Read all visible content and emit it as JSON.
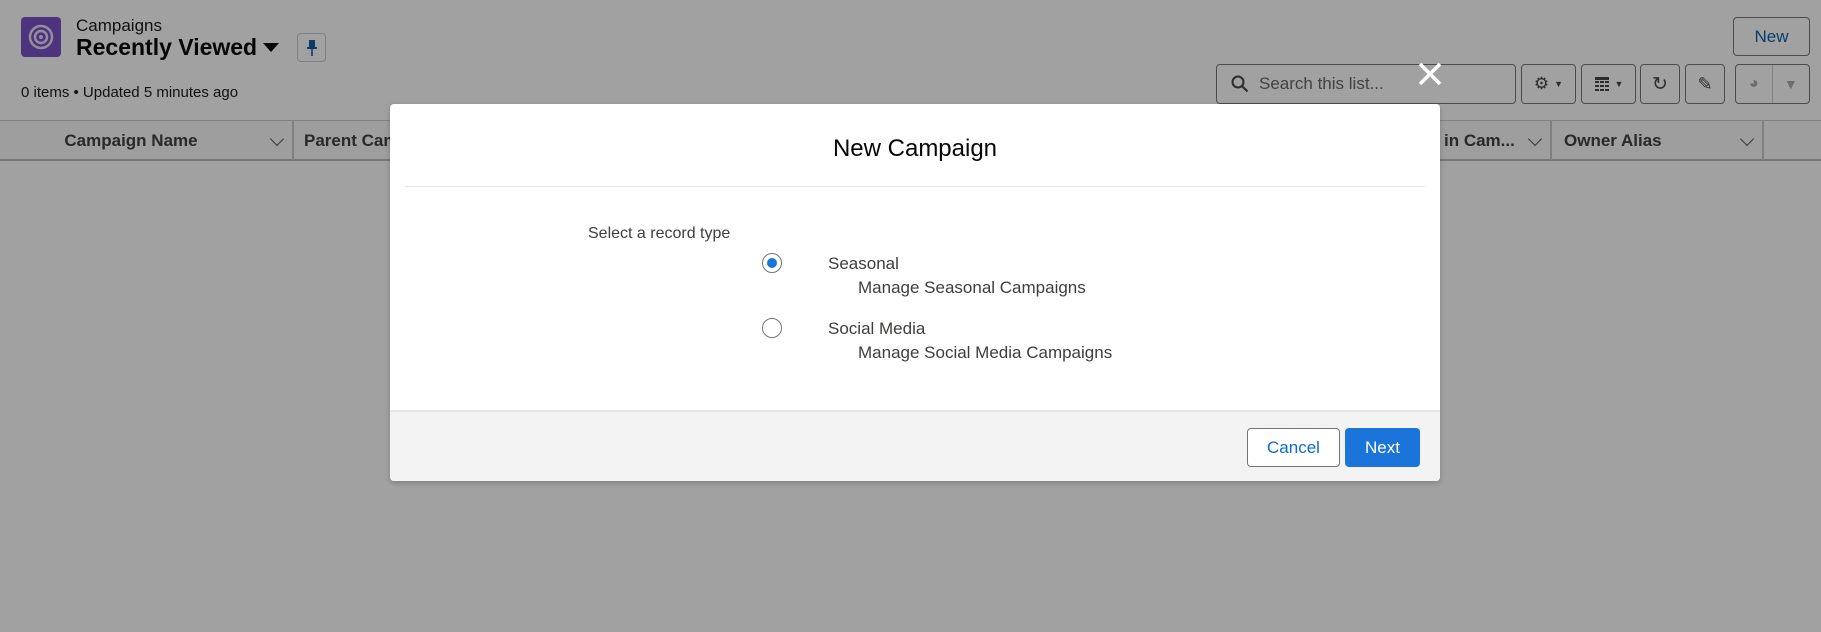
{
  "header": {
    "object_label": "Campaigns",
    "list_view_title": "Recently Viewed",
    "status": "0 items • Updated 5 minutes ago",
    "new_label": "New",
    "icon": "campaign-target-icon",
    "brand_color": "#7a4ec9"
  },
  "toolbar": {
    "search_placeholder": "Search this list...",
    "search_value": "",
    "icons": [
      "gear-icon",
      "table-icon",
      "refresh-icon",
      "pencil-icon",
      "chart-icon",
      "filter-icon"
    ]
  },
  "table": {
    "columns": [
      "Campaign Name",
      "Parent Cam",
      "in Cam...",
      "Owner Alias"
    ]
  },
  "modal": {
    "title": "New Campaign",
    "prompt": "Select a record type",
    "options": [
      {
        "name": "Seasonal",
        "description": "Manage Seasonal Campaigns",
        "selected": true
      },
      {
        "name": "Social Media",
        "description": "Manage Social Media Campaigns",
        "selected": false
      }
    ],
    "cancel_label": "Cancel",
    "next_label": "Next",
    "accent_color": "#1b74d9"
  }
}
